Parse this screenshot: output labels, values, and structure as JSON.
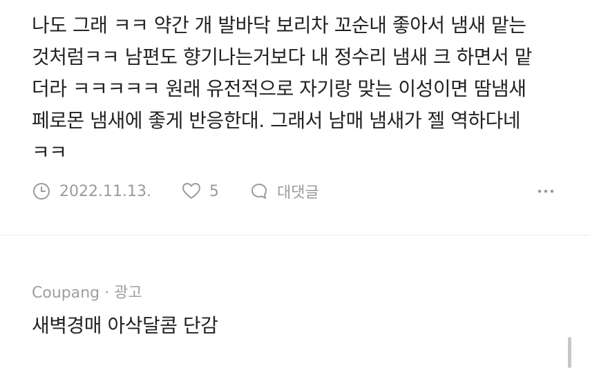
{
  "comment": {
    "lines": [
      "나도 그래 ㅋㅋ 약간 개 발바닥 보리차 꼬순내 좋아서 냄새 맡는",
      "것처럼ㅋㅋ 남편도 향기나는거보다 내 정수리 냄새 크 하면서 맡",
      "더라 ㅋㅋㅋㅋㅋ 원래 유전적으로 자기랑 맞는 이성이면 땀냄새",
      "페로몬 냄새에 좋게 반응한대. 그래서 남매 냄새가 젤 역하다네",
      "ㅋㅋ"
    ],
    "date": "2022.11.13.",
    "likes": "5",
    "reply_label": "대댓글"
  },
  "ad": {
    "label": "Coupang · 광고",
    "title": "새벽경매 아삭달콤 단감"
  },
  "icons": {
    "clock": "clock-icon",
    "heart": "heart-icon",
    "reply": "speech-bubble-icon",
    "more": "more-dots-icon"
  },
  "colors": {
    "text": "#222222",
    "meta": "#9a9a9a",
    "divider": "#ebebeb"
  }
}
